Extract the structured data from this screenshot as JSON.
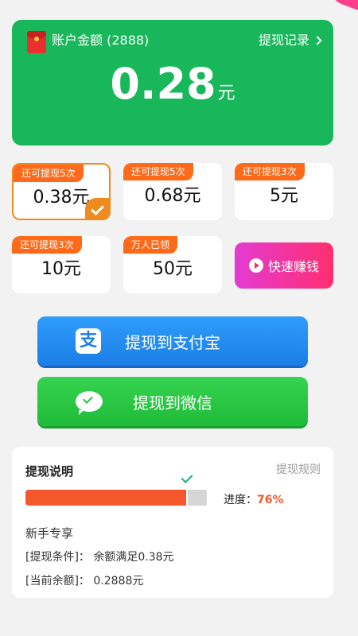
{
  "balance": {
    "account_label": "账户金额 (2888)",
    "record_link": "提现记录",
    "amount": "0.28",
    "unit": "元"
  },
  "options": [
    {
      "badge": "还可提现5次",
      "value": "0.38元",
      "selected": true
    },
    {
      "badge": "还可提现5次",
      "value": "0.68元",
      "selected": false
    },
    {
      "badge": "还可提现3次",
      "value": "5元",
      "selected": false
    },
    {
      "badge": "还可提现3次",
      "value": "10元",
      "selected": false
    },
    {
      "badge": "万人已领",
      "value": "50元",
      "selected": false
    }
  ],
  "quick_earn": {
    "label": "快速赚钱",
    "icon": "play-icon"
  },
  "buttons": {
    "alipay": {
      "label": "提现到支付宝",
      "icon": "alipay-icon",
      "icon_glyph": "支"
    },
    "wechat": {
      "label": "提现到微信",
      "icon": "wechat-icon"
    }
  },
  "info": {
    "title": "提现说明",
    "rules_link": "提现规则",
    "progress_label": "进度：",
    "progress_value": "76%",
    "progress": 0.76,
    "newbie": "新手专享",
    "condition": "[提现条件]：  余额满足0.38元",
    "current": "[当前余额]：  0.2888元"
  },
  "colors": {
    "balance_card": "#17b75a",
    "badge": "#ff6a1a",
    "selected_border": "#f08a1c",
    "alipay": "#1b7ee6",
    "wechat": "#1fbb3a",
    "progress": "#f4572c"
  }
}
